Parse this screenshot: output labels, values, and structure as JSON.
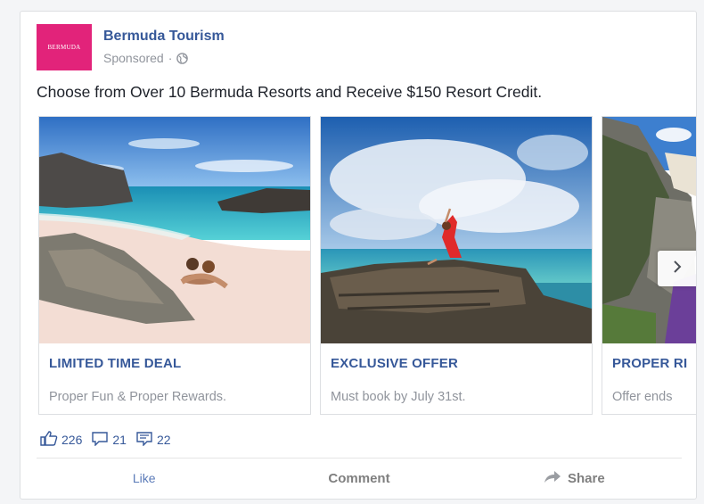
{
  "post": {
    "page_name": "Bermuda Tourism",
    "logo_text": "BERMUDA",
    "sponsored_label": "Sponsored",
    "separator": "·",
    "globe_icon": "globe-icon",
    "message": "Choose from Over 10 Bermuda Resorts and Receive $150 Resort Credit."
  },
  "carousel": {
    "cards": [
      {
        "title": "LIMITED TIME DEAL",
        "description": "Proper Fun & Proper Rewards."
      },
      {
        "title": "EXCLUSIVE OFFER",
        "description": "Must book by July 31st."
      },
      {
        "title": "PROPER RI",
        "description": "Offer ends"
      }
    ],
    "next_icon": "chevron-right-icon"
  },
  "engagement": {
    "likes": "226",
    "comments": "21",
    "shares": "22"
  },
  "actions": {
    "like": "Like",
    "comment": "Comment",
    "share": "Share"
  },
  "colors": {
    "link_blue": "#365899",
    "brand_pink": "#e2237a",
    "meta_gray": "#90949c"
  }
}
